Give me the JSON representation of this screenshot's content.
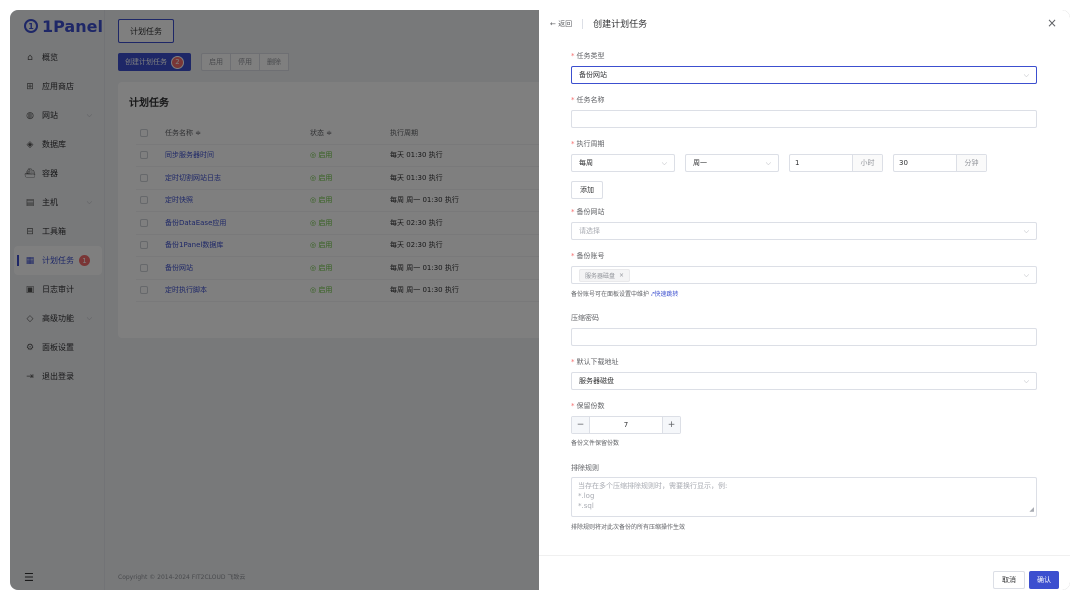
{
  "sidebar": {
    "logo_text": "1Panel",
    "items": [
      {
        "label": "概览",
        "icon": "home-icon",
        "chevron": ""
      },
      {
        "label": "应用商店",
        "icon": "grid-icon",
        "chevron": ""
      },
      {
        "label": "网站",
        "icon": "globe-icon",
        "chevron": "⌵"
      },
      {
        "label": "数据库",
        "icon": "database-icon",
        "chevron": ""
      },
      {
        "label": "容器",
        "icon": "container-icon",
        "chevron": ""
      },
      {
        "label": "主机",
        "icon": "host-icon",
        "chevron": "⌵"
      },
      {
        "label": "工具箱",
        "icon": "toolbox-icon",
        "chevron": ""
      },
      {
        "label": "计划任务",
        "icon": "calendar-icon",
        "chevron": "",
        "badge": "1"
      },
      {
        "label": "日志审计",
        "icon": "log-icon",
        "chevron": ""
      },
      {
        "label": "高级功能",
        "icon": "diamond-icon",
        "chevron": "⌵"
      },
      {
        "label": "面板设置",
        "icon": "settings-icon",
        "chevron": ""
      },
      {
        "label": "退出登录",
        "icon": "logout-icon",
        "chevron": ""
      }
    ]
  },
  "main": {
    "tab_label": "计划任务",
    "create_label": "创建计划任务",
    "create_badge": "2",
    "enable_label": "启用",
    "disable_label": "停用",
    "delete_label": "删除",
    "card_title": "计划任务",
    "table": {
      "headers": {
        "name": "任务名称 ≑",
        "status": "状态 ≑",
        "cycle": "执行周期"
      },
      "rows": [
        {
          "name": "同步服务器时间",
          "status": "◎ 启用",
          "cycle": "每天 01:30 执行"
        },
        {
          "name": "定时切割网站日志",
          "status": "◎ 启用",
          "cycle": "每天 01:30 执行"
        },
        {
          "name": "定时快照",
          "status": "◎ 启用",
          "cycle": "每周 周一 01:30 执行"
        },
        {
          "name": "备份DataEase应用",
          "status": "◎ 启用",
          "cycle": "每天 02:30 执行"
        },
        {
          "name": "备份1Panel数据库",
          "status": "◎ 启用",
          "cycle": "每天 02:30 执行"
        },
        {
          "name": "备份网站",
          "status": "◎ 启用",
          "cycle": "每周 周一 01:30 执行"
        },
        {
          "name": "定时执行脚本",
          "status": "◎ 启用",
          "cycle": "每周 周一 01:30 执行"
        }
      ]
    },
    "footer": "Copyright © 2014-2024 FIT2CLOUD 飞致云"
  },
  "drawer": {
    "back_label": "← 返回",
    "title": "创建计划任务",
    "close_icon": "×",
    "task_type_label": "任务类型",
    "task_type_value": "备份网站",
    "task_name_label": "任务名称",
    "task_name_value": "",
    "cycle_label": "执行周期",
    "cycle_period": "每周",
    "cycle_weekday": "周一",
    "cycle_hour": "1",
    "cycle_hour_unit": "小时",
    "cycle_minute": "30",
    "cycle_minute_unit": "分钟",
    "add_label": "添加",
    "backup_site_label": "备份网站",
    "backup_site_placeholder": "请选择",
    "backup_account_label": "备份账号",
    "backup_account_tag": "服务器磁盘",
    "backup_account_hint": "备份账号可在面板设置中维护",
    "backup_account_link": "快速跳转",
    "compress_pwd_label": "压缩密码",
    "compress_pwd_value": "",
    "default_download_label": "默认下载地址",
    "default_download_value": "服务器磁盘",
    "retain_label": "保留份数",
    "retain_value": "7",
    "retain_hint": "备份文件保留份数",
    "exclude_label": "排除规则",
    "exclude_placeholder_lines": [
      "当存在多个压缩排除规则时，需要换行显示，例:",
      "*.log",
      "*.sql"
    ],
    "exclude_hint": "排除规则将对此次备份的所有压缩操作生效",
    "cancel_label": "取消",
    "confirm_label": "确认"
  },
  "colors": {
    "accent": "#3c4fcf",
    "success": "#67c23a",
    "danger": "#f56c6c"
  }
}
